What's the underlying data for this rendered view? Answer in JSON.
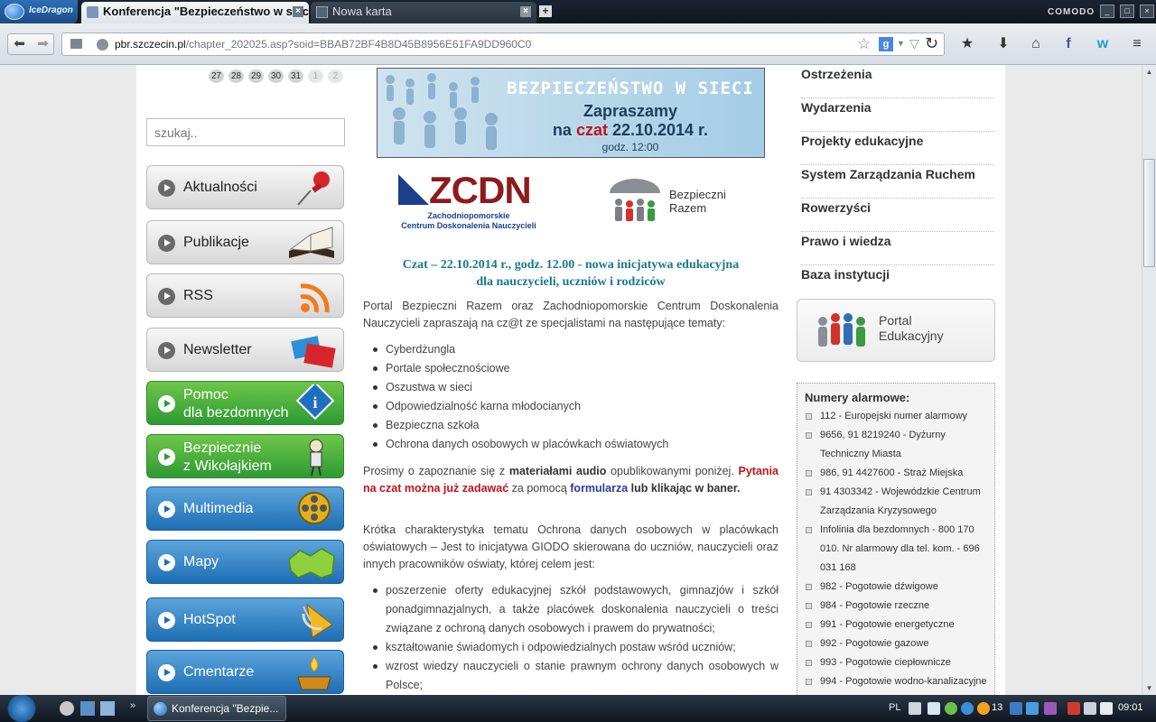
{
  "browser": {
    "app_name": "IceDragon",
    "brand": "COMODO",
    "tabs": [
      {
        "title": "Konferencja \"Bezpieczeństwo w sieci\"",
        "active": true
      },
      {
        "title": "Nowa karta",
        "active": false
      }
    ],
    "url_host": "pbr.szczecin.pl",
    "url_path": "/chapter_202025.asp?soid=BBAB72BF4B8D45B8956E61FA9DD960C0",
    "search_engine_icon": "g-icon"
  },
  "calendar": {
    "days": [
      "27",
      "28",
      "29",
      "30",
      "31",
      "1",
      "2"
    ]
  },
  "search": {
    "placeholder": "szukaj.."
  },
  "left_nav": [
    {
      "label": "Aktualności",
      "style": "gray",
      "icon": "pushpin-icon"
    },
    {
      "label": "Publikacje",
      "style": "gray",
      "icon": "book-icon"
    },
    {
      "label": "RSS",
      "style": "gray",
      "icon": "rss-icon"
    },
    {
      "label": "Newsletter",
      "style": "gray",
      "icon": "envelope-icon"
    },
    {
      "label_line1": "Pomoc",
      "label_line2": "dla bezdomnych",
      "style": "green",
      "icon": "info-icon"
    },
    {
      "label_line1": "Bezpiecznie",
      "label_line2": "z Wikołajkiem",
      "style": "green",
      "icon": "mascot-icon"
    },
    {
      "label": "Multimedia",
      "style": "blue",
      "icon": "film-reel-icon"
    },
    {
      "label": "Mapy",
      "style": "blue",
      "icon": "map-icon"
    },
    {
      "label": "HotSpot",
      "style": "blue",
      "icon": "satellite-dish-icon"
    },
    {
      "label": "Cmentarze",
      "style": "blue",
      "icon": "candle-icon"
    }
  ],
  "banner": {
    "title": "BEZPIECZEŃSTWO W SIECI",
    "line2": "Zapraszamy",
    "line3_pre": "na ",
    "line3_red": "czat",
    "line3_post": " 22.10.2014 r.",
    "line4": "godz. 12:00"
  },
  "logos": {
    "zcdn_word": "ZCDN",
    "zcdn_sub1": "Zachodniopomorskie",
    "zcdn_sub2": "Centrum Doskonalenia Nauczycieli",
    "bezp_line1": "Bezpieczni",
    "bezp_line2": "Razem"
  },
  "article": {
    "headline_line1": "Czat – 22.10.2014 r., godz. 12.00 - nowa inicjatywa edukacyjna",
    "headline_line2": "dla nauczycieli, uczniów i rodziców",
    "intro": "Portal Bezpieczni Razem oraz Zachodniopomorskie Centrum Doskonalenia Nauczycieli zapraszają na cz@t ze specjalistami na następujące tematy:",
    "topics": [
      "Cyberdżungla",
      "Portale społecznościowe",
      "Oszustwa w sieci",
      "Odpowiedzialność karna młodocianych",
      "Bezpieczna szkoła",
      "Ochrona danych osobowych w placówkach oświatowych"
    ],
    "p2_a": "Prosimy o zapoznanie się z ",
    "p2_b": "materiałami audio",
    "p2_c": " opublikowanymi poniżej. ",
    "p2_d": "Pytania na czat można już zadawać",
    "p2_e": " za pomocą ",
    "p2_f": "formularza",
    "p2_g": " lub klikając w baner.",
    "p3": "Krótka charakterystyka tematu Ochrona danych osobowych w placówkach oświatowych – Jest to inicjatywa GIODO skierowana do uczniów, nauczycieli oraz innych pracowników oświaty, której celem jest:",
    "goals": [
      "poszerzenie oferty edukacyjnej szkół podstawowych, gimnazjów i szkół ponadgimnazjalnych, a także placówek doskonalenia nauczycieli o treści związane z ochroną danych osobowych i prawem do prywatności;",
      "kształtowanie świadomych i odpowiedzialnych postaw wśród uczniów;",
      "wzrost wiedzy nauczycieli o stanie prawnym ochrony danych osobowych w Polsce;"
    ]
  },
  "right_nav": [
    "Ostrzeżenia",
    "Wydarzenia",
    "Projekty edukacyjne",
    "System Zarządzania Ruchem",
    "Rowerzyści",
    "Prawo i wiedza",
    "Baza instytucji"
  ],
  "portal": {
    "line1": "Portal",
    "line2": "Edukacyjny"
  },
  "alarm": {
    "heading": "Numery alarmowe:",
    "items": [
      "112 - Europejski numer alarmowy",
      "9656, 91 8219240 - Dyżurny Techniczny Miasta",
      "986, 91 4427600 - Straż Miejska",
      "91 4303342 - Wojewódzkie Centrum Zarządzania Kryzysowego",
      "Infolinia dla bezdomnych - 800 170 010. Nr alarmowy dla tel. kom. - 696 031 168",
      "982 - Pogotowie dźwigowe",
      "984 - Pogotowie rzeczne",
      "991 - Pogotowie energetyczne",
      "992 - Pogotowie gazowe",
      "993 - Pogotowie ciepłownicze",
      "994 - Pogotowie wodno-kanalizacyjne"
    ]
  },
  "taskbar": {
    "task_title": "Konferencja \"Bezpie...",
    "lang": "PL",
    "temp": "13",
    "clock": "09:01"
  },
  "colors": {
    "headline": "#177a8c",
    "red": "#c0141b",
    "link_blue": "#2a3b9a",
    "nav_green": "#3aa83a",
    "nav_blue": "#2b7fc4"
  }
}
